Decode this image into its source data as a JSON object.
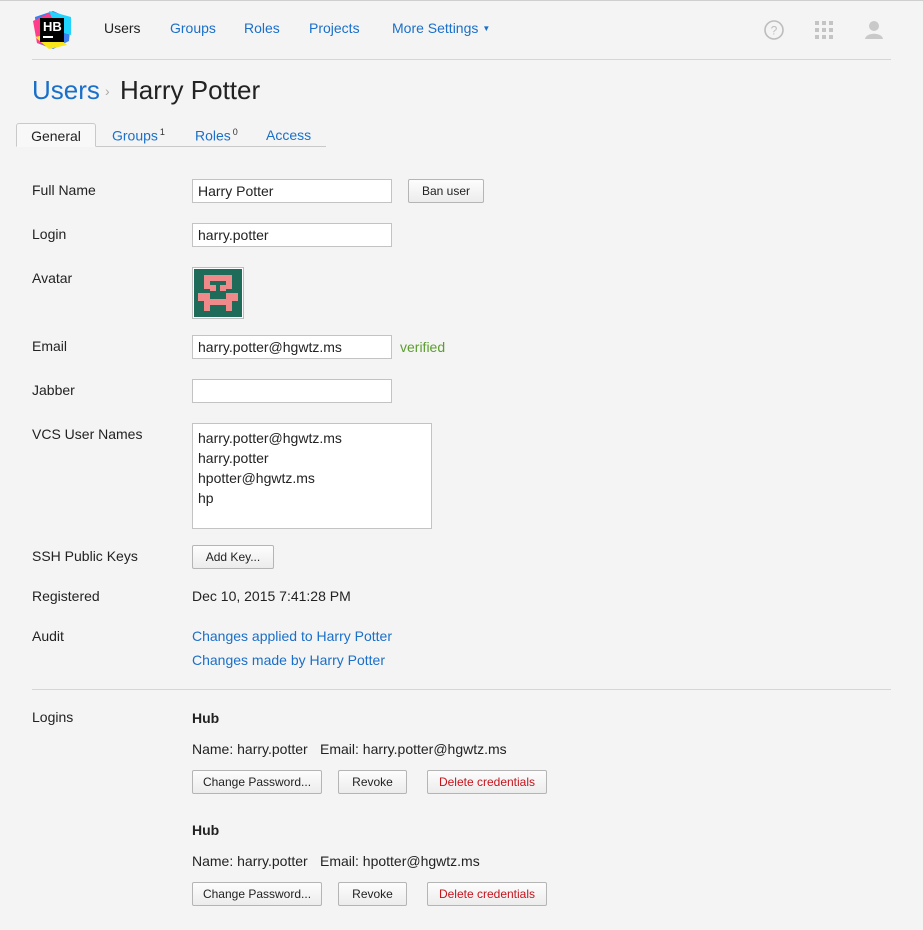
{
  "app": {
    "logo_text": "HB",
    "nav": [
      "Users",
      "Groups",
      "Roles",
      "Projects",
      "More Settings"
    ]
  },
  "breadcrumb": {
    "root": "Users",
    "separator": "›",
    "current": "Harry Potter"
  },
  "tabs": [
    {
      "label": "General"
    },
    {
      "label": "Groups",
      "count": "1"
    },
    {
      "label": "Roles",
      "count": "0"
    },
    {
      "label": "Access"
    }
  ],
  "form": {
    "full_name": {
      "label": "Full Name",
      "value": "Harry Potter",
      "button": "Ban user"
    },
    "login": {
      "label": "Login",
      "value": "harry.potter"
    },
    "avatar": {
      "label": "Avatar"
    },
    "email": {
      "label": "Email",
      "value": "harry.potter@hgwtz.ms",
      "status": "verified"
    },
    "jabber": {
      "label": "Jabber",
      "value": ""
    },
    "vcs": {
      "label": "VCS User Names",
      "values": [
        "harry.potter@hgwtz.ms",
        "harry.potter",
        "hpotter@hgwtz.ms",
        "hp"
      ]
    },
    "ssh": {
      "label": "SSH Public Keys",
      "button": "Add Key..."
    },
    "registered": {
      "label": "Registered",
      "value": "Dec 10, 2015 7:41:28 PM"
    },
    "audit": {
      "label": "Audit",
      "links": [
        "Changes applied to Harry Potter",
        "Changes made by Harry Potter"
      ]
    }
  },
  "logins": {
    "label": "Logins",
    "entries": [
      {
        "title": "Hub",
        "name": "Name: harry.potter",
        "email": "Email: harry.potter@hgwtz.ms",
        "buttons": {
          "change": "Change Password...",
          "revoke": "Revoke",
          "delete": "Delete credentials"
        }
      },
      {
        "title": "Hub",
        "name": "Name: harry.potter",
        "email": "Email: hpotter@hgwtz.ms",
        "buttons": {
          "change": "Change Password...",
          "revoke": "Revoke",
          "delete": "Delete credentials"
        }
      }
    ]
  },
  "icons": [
    "help-icon",
    "apps-grid-icon",
    "user-profile-icon"
  ],
  "colors": {
    "link": "#1a6fc9",
    "verified": "#5b9e2f",
    "danger": "#c4141c",
    "avatar_bg": "#1f6b5a",
    "avatar_fg": "#f08a8a"
  }
}
